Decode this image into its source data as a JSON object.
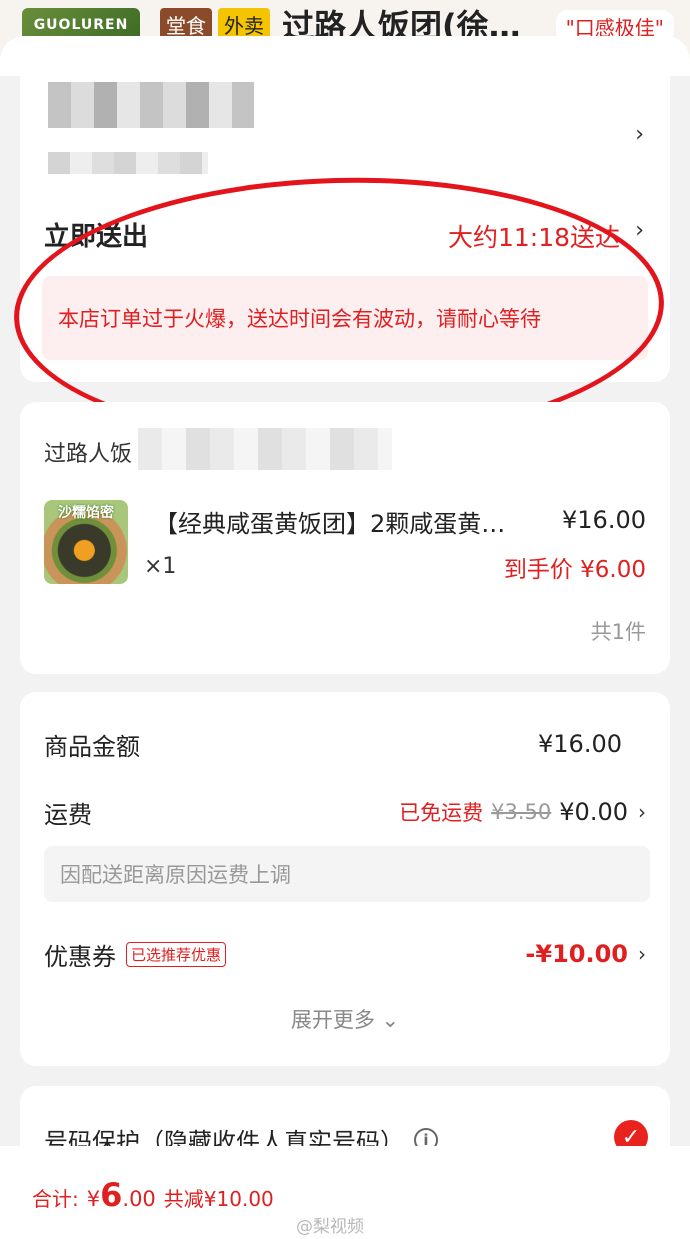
{
  "header": {
    "logo_text": "GUOLUREN",
    "tag_tangshi": "堂食",
    "tag_waimai": "外卖",
    "shop_name": "过路人饭团(徐…",
    "slogan": "\"口感极佳\""
  },
  "address": {
    "chevron": "›"
  },
  "delivery": {
    "label": "立即送出",
    "eta": "大约11:18送达",
    "chevron": "›",
    "notice": "本店订单过于火爆，送达时间会有波动，请耐心等待"
  },
  "store": {
    "name": "过路人饭",
    "product": {
      "image_text": "沙糯馅密",
      "title": "【经典咸蛋黄饭团】2颗咸蛋黄…",
      "price": "¥16.00",
      "qty": "×1",
      "final_price": "到手价 ¥6.00"
    },
    "count": "共1件"
  },
  "fees": {
    "goods_label": "商品金额",
    "goods_value": "¥16.00",
    "shipping_label": "运费",
    "shipping_free": "已免运费",
    "shipping_original": "¥3.50",
    "shipping_value": "¥0.00",
    "shipping_note": "因配送距离原因运费上调",
    "coupon_label": "优惠券",
    "coupon_badge": "已选推荐优惠",
    "coupon_value": "-¥10.00",
    "expand": "展开更多 ⌄"
  },
  "privacy": {
    "label": "号码保护（隐藏收件人真实号码）",
    "info": "i",
    "checked_icon": "✓"
  },
  "footer": {
    "total_label": "合计:",
    "currency": "¥",
    "total_int": "6",
    "total_dec": ".00",
    "discount": "共减¥10.00",
    "watermark": "@梨视频"
  },
  "colors": {
    "accent_red": "#e02020",
    "notice_bg": "#fdeef0",
    "annotation_red": "#e4141c"
  }
}
